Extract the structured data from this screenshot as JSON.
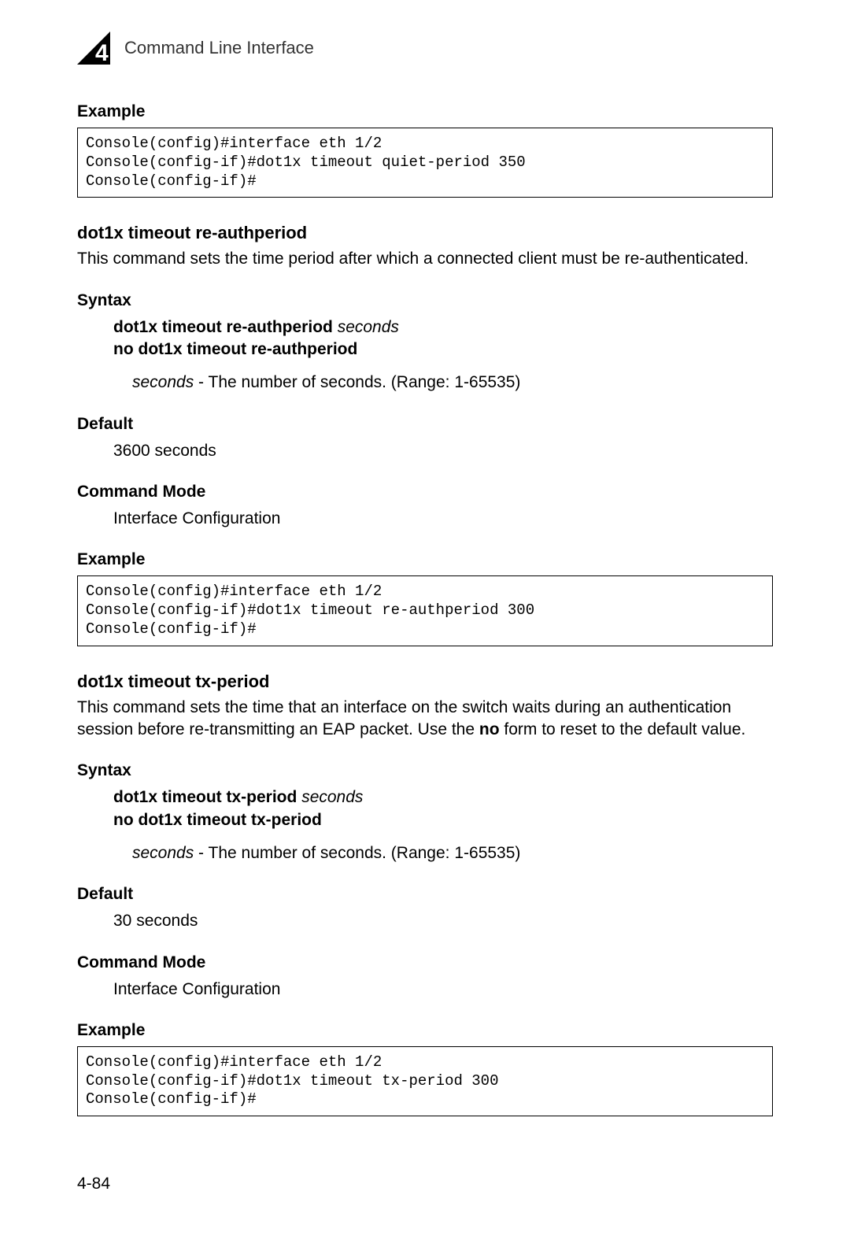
{
  "header": {
    "chapter_number": "4",
    "title": "Command Line Interface"
  },
  "block0": {
    "heading": "Example",
    "code": "Console(config)#interface eth 1/2\nConsole(config-if)#dot1x timeout quiet-period 350\nConsole(config-if)#"
  },
  "cmd1": {
    "title": "dot1x timeout re-authperiod",
    "description": "This command sets the time period after which a connected client must be re-authenticated.",
    "syntax_heading": "Syntax",
    "syntax_cmd_bold": "dot1x timeout re-authperiod",
    "syntax_cmd_param": "seconds",
    "syntax_no": "no dot1x timeout re-authperiod",
    "param_name": "seconds",
    "param_desc": " - The number of seconds. (Range: 1-65535)",
    "default_heading": "Default",
    "default_value": "3600 seconds",
    "mode_heading": "Command Mode",
    "mode_value": "Interface Configuration",
    "example_heading": "Example",
    "example_code": "Console(config)#interface eth 1/2\nConsole(config-if)#dot1x timeout re-authperiod 300\nConsole(config-if)#"
  },
  "cmd2": {
    "title": "dot1x timeout tx-period",
    "description_pre": "This command sets the time that an interface on the switch waits during an authentication session before re-transmitting an EAP packet. Use the ",
    "description_no": "no",
    "description_post": " form to reset to the default value.",
    "syntax_heading": "Syntax",
    "syntax_cmd_bold": "dot1x timeout tx-period",
    "syntax_cmd_param": "seconds",
    "syntax_no": "no dot1x timeout tx-period",
    "param_name": "seconds",
    "param_desc": " - The number of seconds. (Range: 1-65535)",
    "default_heading": "Default",
    "default_value": "30 seconds",
    "mode_heading": "Command Mode",
    "mode_value": "Interface Configuration",
    "example_heading": "Example",
    "example_code": "Console(config)#interface eth 1/2\nConsole(config-if)#dot1x timeout tx-period 300\nConsole(config-if)#"
  },
  "page_number": "4-84"
}
